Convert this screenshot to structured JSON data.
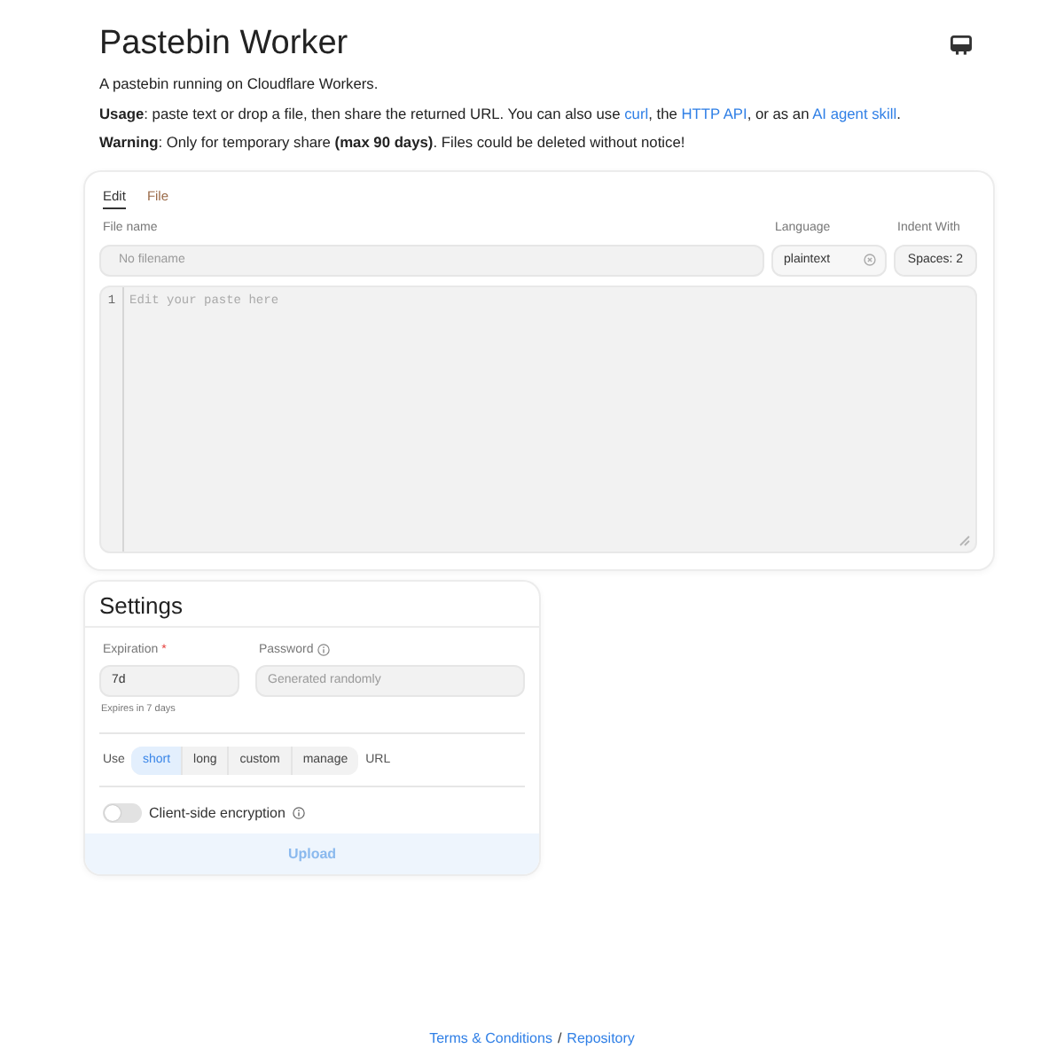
{
  "header": {
    "title": "Pastebin Worker"
  },
  "intro": [
    {
      "segments": [
        {
          "kind": "text",
          "text": "A pastebin running on Cloudflare Workers."
        }
      ]
    },
    {
      "segments": [
        {
          "kind": "text",
          "text": "**Usage**: paste text or drop a file, then share the returned URL. You can also use "
        },
        {
          "kind": "link",
          "text": "curl"
        },
        {
          "kind": "text",
          "text": ", the "
        },
        {
          "kind": "link",
          "text": "HTTP API"
        },
        {
          "kind": "text",
          "text": ", or as an "
        },
        {
          "kind": "link",
          "text": "AI agent skill"
        },
        {
          "kind": "text",
          "text": "."
        }
      ]
    },
    {
      "segments": [
        {
          "kind": "text",
          "text": "**Warning**: Only for temporary share **(max 90 days)**. Files could be deleted without notice!"
        }
      ]
    }
  ],
  "editor": {
    "tabs": [
      {
        "label": "Edit",
        "selected": true
      },
      {
        "label": "File",
        "selected": false
      }
    ],
    "file_name": {
      "label": "File name",
      "placeholder": "No filename"
    },
    "language": {
      "label": "Language",
      "value": "plaintext"
    },
    "indent": {
      "label": "Indent With",
      "value": "Spaces: 2"
    },
    "code": {
      "line_number": "1",
      "placeholder": "Edit your paste here"
    }
  },
  "settings": {
    "title": "Settings",
    "expiration": {
      "label": "Expiration",
      "required_mark": "*",
      "value": "7d",
      "hint": "Expires in 7 days"
    },
    "password": {
      "label": "Password",
      "placeholder": "Generated randomly"
    },
    "url_type": {
      "prefix": "Use",
      "options": [
        {
          "label": "short",
          "selected": true
        },
        {
          "label": "long",
          "selected": false
        },
        {
          "label": "custom",
          "selected": false
        },
        {
          "label": "manage",
          "selected": false
        }
      ],
      "suffix": "URL"
    },
    "encryption": {
      "label": "Client-side encryption",
      "on": false
    },
    "upload": {
      "label": "Upload",
      "disabled": true
    }
  },
  "footer": {
    "links": [
      {
        "label": "Terms & Conditions"
      },
      {
        "label": "Repository"
      }
    ],
    "separator": "/"
  }
}
